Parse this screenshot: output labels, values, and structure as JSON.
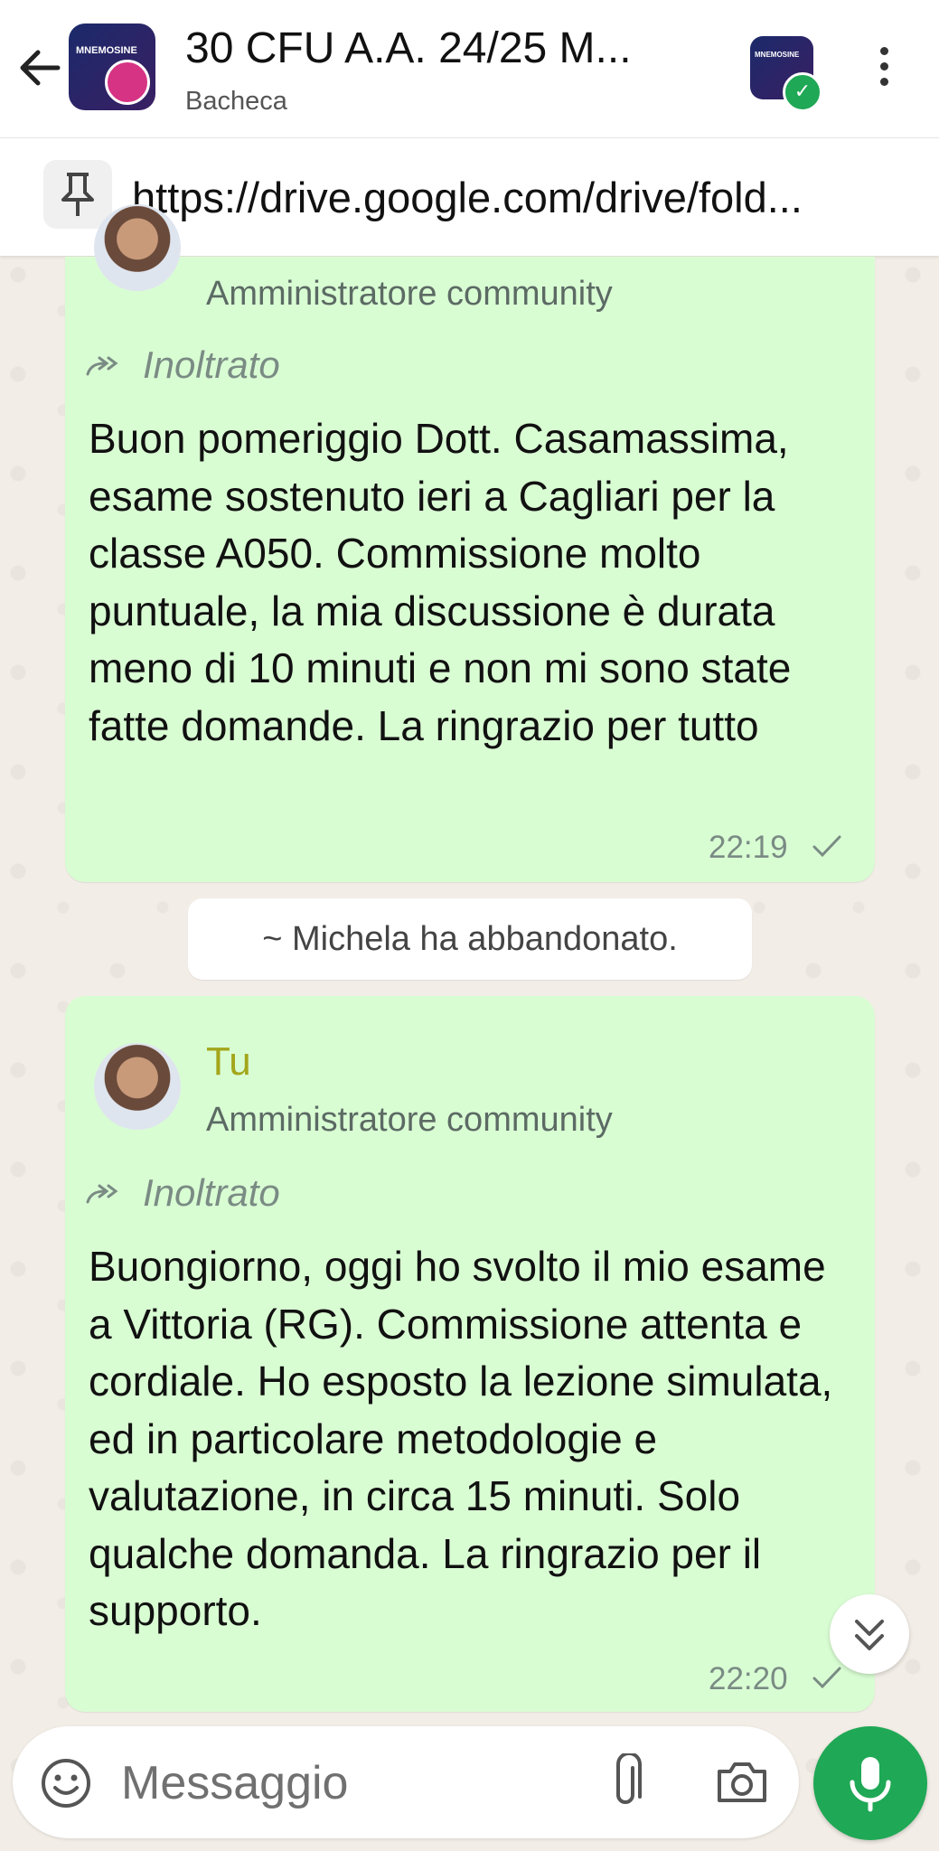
{
  "header": {
    "title": "30 CFU A.A. 24/25 M...",
    "subtitle": "Bacheca",
    "group_icon_text": "MNEMOSINE",
    "community_icon_text": "MNEMOSINE"
  },
  "pinned": {
    "link": "https://drive.google.com/drive/fold..."
  },
  "messages": [
    {
      "role": "Amministratore community",
      "forwarded": "Inoltrato",
      "text": "Buon pomeriggio Dott. Casamassima, esame sostenuto ieri a Cagliari per la classe A050. Commissione molto puntuale, la mia discussione è durata meno di 10 minuti e non mi sono state fatte domande. La ringrazio per tutto",
      "time": "22:19"
    },
    {
      "sender": "Tu",
      "role": "Amministratore community",
      "forwarded": "Inoltrato",
      "text": "Buongiorno, oggi ho svolto il mio esame a Vittoria (RG). Commissione attenta e cordiale. Ho esposto la lezione simulata, ed in particolare metodologie e valutazione, in circa 15 minuti. Solo qualche domanda. La ringrazio per il supporto.",
      "time": "22:20"
    }
  ],
  "system_message": "~ Michela ha abbandonato.",
  "composer": {
    "placeholder": "Messaggio"
  },
  "colors": {
    "bubble": "#d9fdd3",
    "accent": "#1fa855",
    "sender_name": "#a3a61b"
  }
}
